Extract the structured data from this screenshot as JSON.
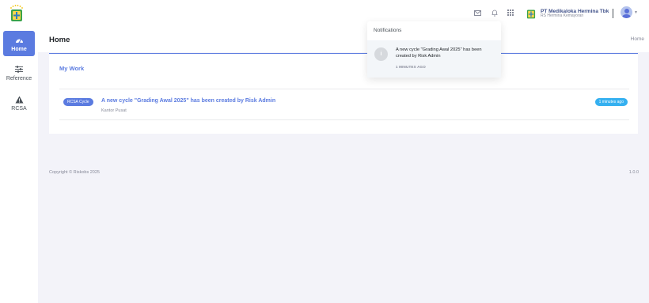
{
  "topbar": {
    "org_name": "PT Medikaloka Hermina Tbk",
    "org_unit": "RS Hermina Kemayoran",
    "icons": [
      "mail-icon",
      "bell-icon",
      "apps-grid-icon"
    ]
  },
  "sidebar": {
    "items": [
      {
        "label": "Home",
        "icon": "dashboard-gauge-icon",
        "active": true
      },
      {
        "label": "Reference",
        "icon": "sliders-icon",
        "active": false
      },
      {
        "label": "RCSA",
        "icon": "warning-icon",
        "active": false
      }
    ]
  },
  "page": {
    "title": "Home",
    "breadcrumb": "Home"
  },
  "card": {
    "title": "My Work",
    "items": [
      {
        "badge": "RCSA Cycle",
        "title": "A new cycle \"Grading Awal 2025\" has been created by Risk Admin",
        "subtitle": "Kantor Pusat",
        "time": "1 minutes ago"
      }
    ]
  },
  "footer": {
    "copyright": "Copyright © Riskobs 2025",
    "version": "1.0.0"
  },
  "notifications": {
    "title": "Notifications",
    "items": [
      {
        "icon_letter": "i",
        "text": "A new cycle \"Grading Awal 2025\" has been created by Risk Admin",
        "time": "1 MINUTES AGO"
      }
    ]
  },
  "colors": {
    "primary": "#5b7be0",
    "info": "#35b0f0",
    "page_bg": "#f3f3f9",
    "muted": "#878a99"
  }
}
